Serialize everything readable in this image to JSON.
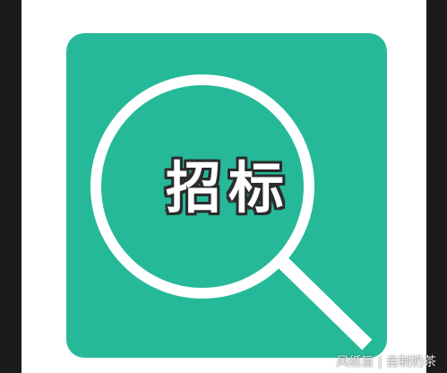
{
  "image": {
    "title_text": "招标",
    "watermark_text": "风纸旨 | 自制奶茶"
  },
  "colors": {
    "background": "#1b1b1b",
    "panel": "#ffffff",
    "tile": "#26b999",
    "magnifier": "#ffffff",
    "text_outline": "#2c2c2c"
  },
  "icons": {
    "main_icon": "magnifying-glass-icon"
  }
}
